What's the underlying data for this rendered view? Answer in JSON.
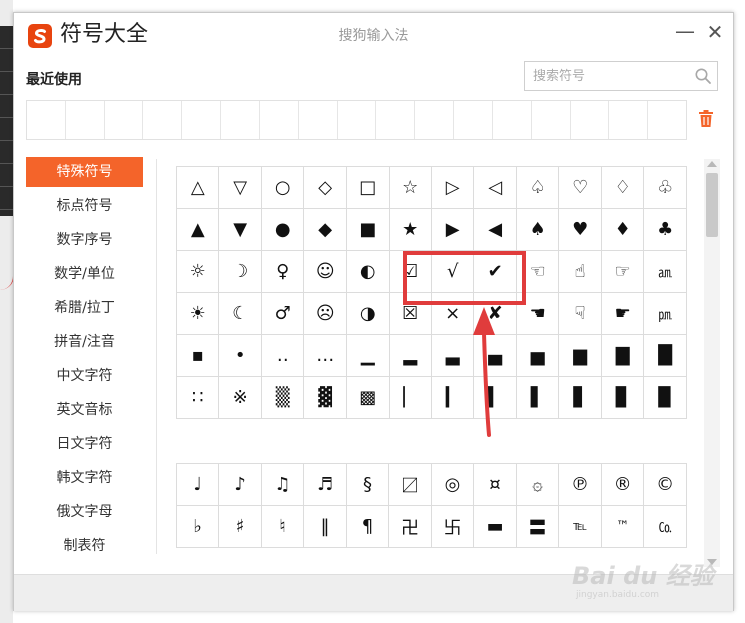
{
  "window": {
    "title": "符号大全",
    "brand": "搜狗输入法",
    "minimize_glyph": "—",
    "close_glyph": "✕"
  },
  "recent": {
    "label": "最近使用"
  },
  "search": {
    "placeholder": "搜索符号",
    "value": ""
  },
  "categories": [
    {
      "label": "特殊符号",
      "active": true
    },
    {
      "label": "标点符号"
    },
    {
      "label": "数字序号"
    },
    {
      "label": "数学/单位"
    },
    {
      "label": "希腊/拉丁"
    },
    {
      "label": "拼音/注音"
    },
    {
      "label": "中文字符"
    },
    {
      "label": "英文音标"
    },
    {
      "label": "日文字符"
    },
    {
      "label": "韩文字符"
    },
    {
      "label": "俄文字母"
    },
    {
      "label": "制表符"
    }
  ],
  "symbols_grid_1": [
    [
      "△",
      "▽",
      "○",
      "◇",
      "□",
      "☆",
      "▷",
      "◁",
      "♤",
      "♡",
      "♢",
      "♧"
    ],
    [
      "▲",
      "▼",
      "●",
      "◆",
      "■",
      "★",
      "▶",
      "◀",
      "♠",
      "♥",
      "♦",
      "♣"
    ],
    [
      "☼",
      "☽",
      "♀",
      "☺",
      "◐",
      "☑",
      "√",
      "✔",
      "☜",
      "☝",
      "☞",
      "㏂"
    ],
    [
      "☀",
      "☾",
      "♂",
      "☹",
      "◑",
      "☒",
      "×",
      "✘",
      "☚",
      "☟",
      "☛",
      "㏘"
    ],
    [
      "▪",
      "•",
      "‥",
      "…",
      "▁",
      "▂",
      "▃",
      "▄",
      "▅",
      "▆",
      "▇",
      "█"
    ],
    [
      "∷",
      "※",
      "▒",
      "▓",
      "▩",
      "▏",
      "▎",
      "▍",
      "▌",
      "▋",
      "▊",
      "▉"
    ]
  ],
  "symbols_grid_2": [
    [
      "♩",
      "♪",
      "♫",
      "♬",
      "§",
      "〼",
      "◎",
      "¤",
      "۞",
      "℗",
      "®",
      "©"
    ],
    [
      "♭",
      "♯",
      "♮",
      "‖",
      "¶",
      "卍",
      "卐",
      "▬",
      "〓",
      "℡",
      "™",
      "㏇"
    ]
  ],
  "watermark": {
    "text": "Bai du 经验",
    "url": "jingyan.baidu.com"
  }
}
